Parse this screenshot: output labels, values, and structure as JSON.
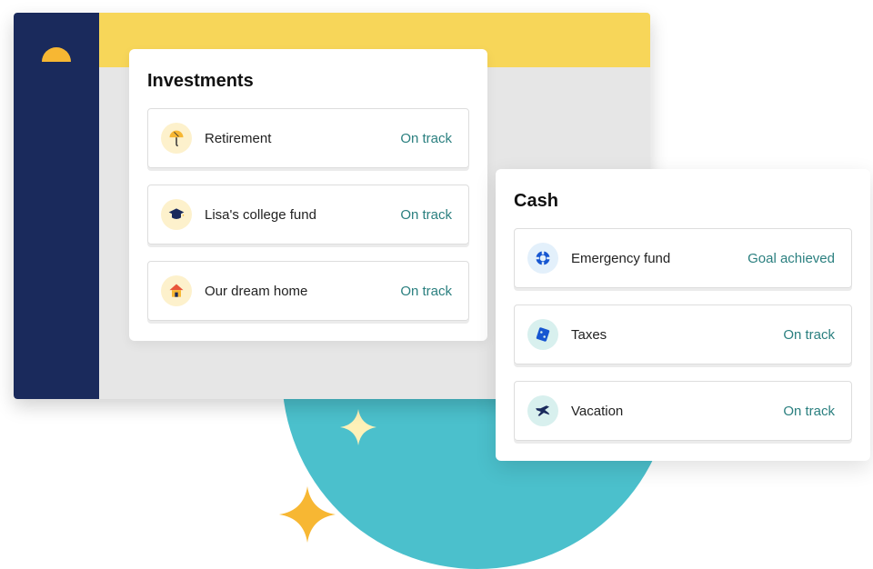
{
  "investments": {
    "title": "Investments",
    "items": [
      {
        "name": "Retirement",
        "status": "On track",
        "icon": "umbrella"
      },
      {
        "name": "Lisa's college fund",
        "status": "On track",
        "icon": "graduation-cap"
      },
      {
        "name": "Our dream home",
        "status": "On track",
        "icon": "house"
      }
    ]
  },
  "cash": {
    "title": "Cash",
    "items": [
      {
        "name": "Emergency fund",
        "status": "Goal achieved",
        "icon": "life-ring"
      },
      {
        "name": "Taxes",
        "status": "On track",
        "icon": "receipt"
      },
      {
        "name": "Vacation",
        "status": "On track",
        "icon": "airplane"
      }
    ]
  },
  "colors": {
    "sidebar": "#1a2a5c",
    "topbar": "#f7d659",
    "accent": "#fbb034",
    "status": "#2a7f7f",
    "circle": "#4bc0cc"
  }
}
